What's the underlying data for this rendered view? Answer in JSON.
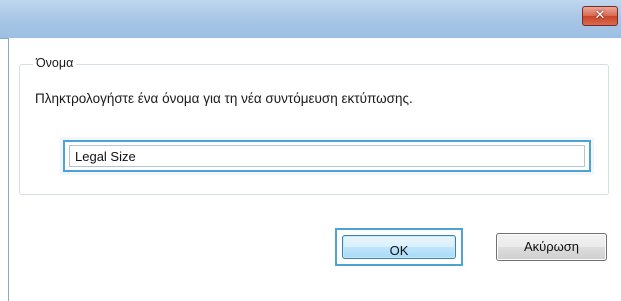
{
  "window": {
    "close_glyph": "✕",
    "close_icon": "close-icon"
  },
  "group": {
    "title": "Όνομα",
    "description": "Πληκτρολογήστε ένα όνομα για τη νέα συντόμευση εκτύπωσης."
  },
  "name_field": {
    "value": "Legal Size"
  },
  "buttons": {
    "ok_label": "OK",
    "cancel_label": "Ακύρωση"
  },
  "colors": {
    "focus_accent": "#4ea3d5",
    "titlebar": "#a9c7e6",
    "close_button": "#c8452c"
  }
}
